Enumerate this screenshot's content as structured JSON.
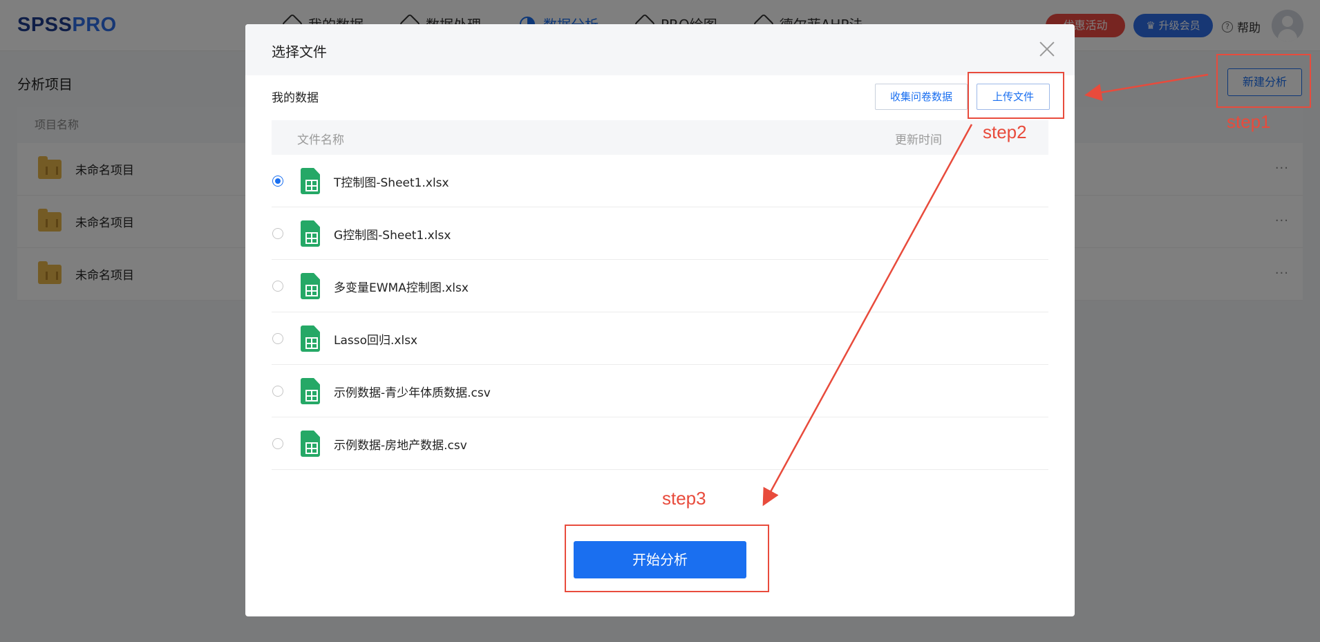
{
  "app": {
    "logo_part1": "SPSS",
    "logo_part2": "PRO",
    "nav": [
      {
        "label": "我的数据",
        "icon": "data-icon"
      },
      {
        "label": "数据处理",
        "icon": "layers-icon"
      },
      {
        "label": "数据分析",
        "icon": "pie-chart-icon",
        "active": true
      },
      {
        "label": "PRO绘图",
        "icon": "chart-icon"
      },
      {
        "label": "德尔菲AHP法",
        "icon": "clipboard-icon"
      }
    ],
    "promo_label": "优惠活动",
    "vip_label": "升级会员",
    "help_label": "帮助"
  },
  "page": {
    "title": "分析项目",
    "new_analysis_label": "新建分析",
    "table_header": "项目名称",
    "projects": [
      {
        "name": "未命名项目"
      },
      {
        "name": "未命名项目"
      },
      {
        "name": "未命名项目"
      }
    ],
    "more_label": "···"
  },
  "modal": {
    "title": "选择文件",
    "section_label": "我的数据",
    "collect_label": "收集问卷数据",
    "upload_label": "上传文件",
    "col_name": "文件名称",
    "col_time": "更新时间",
    "files": [
      {
        "name": "T控制图-Sheet1.xlsx",
        "selected": true
      },
      {
        "name": "G控制图-Sheet1.xlsx",
        "selected": false
      },
      {
        "name": "多变量EWMA控制图.xlsx",
        "selected": false
      },
      {
        "name": "Lasso回归.xlsx",
        "selected": false
      },
      {
        "name": "示例数据-青少年体质数据.csv",
        "selected": false
      },
      {
        "name": "示例数据-房地产数据.csv",
        "selected": false
      }
    ],
    "start_label": "开始分析"
  },
  "annotations": {
    "step1": "step1",
    "step2": "step2",
    "step3": "step3",
    "color": "#e84b3c"
  },
  "colors": {
    "accent": "#1a6ff0",
    "file_icon": "#25a866",
    "folder_icon": "#e9b64a",
    "promo": "#ef4a43"
  }
}
